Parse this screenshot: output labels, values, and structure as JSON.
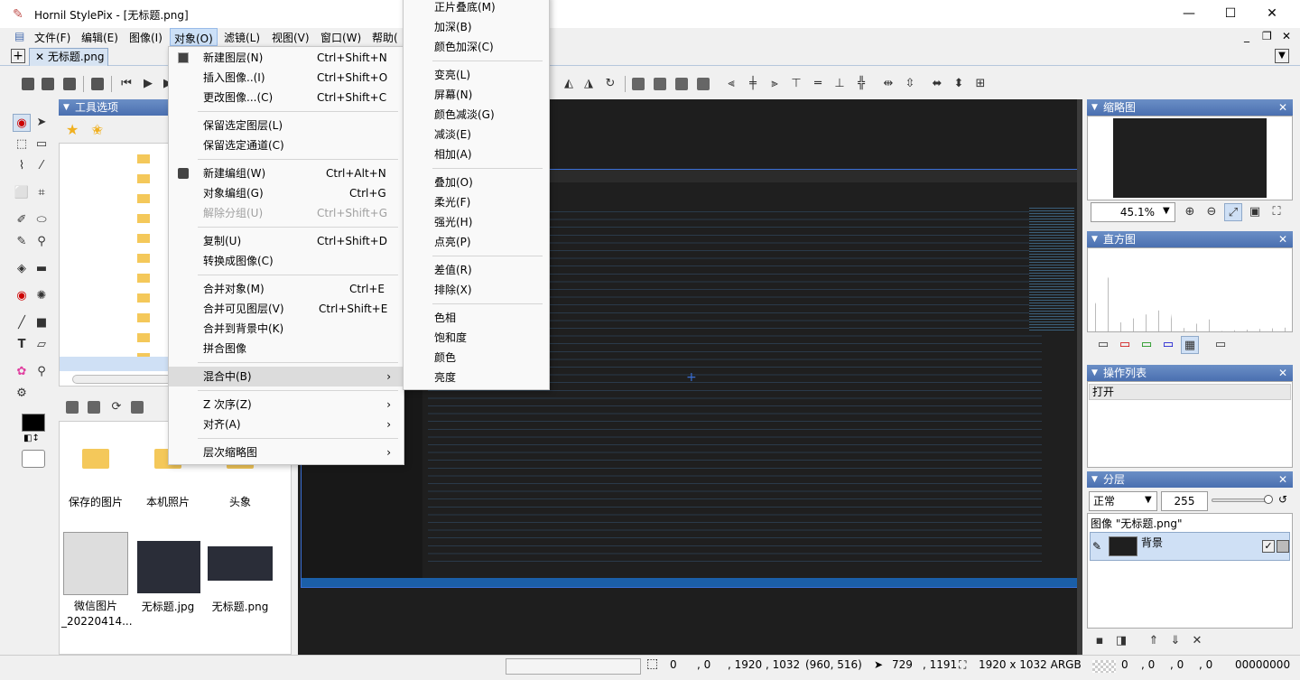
{
  "window": {
    "title": "Hornil StylePix - [无标题.png]"
  },
  "menubar": {
    "items": [
      "文件(F)",
      "编辑(E)",
      "图像(I)",
      "对象(O)",
      "滤镜(L)",
      "视图(V)",
      "窗口(W)",
      "帮助("
    ]
  },
  "tabs": {
    "doc": "✕ 无标题.png"
  },
  "left_panel": {
    "title": "工具选项"
  },
  "files": [
    {
      "name": "保存的图片"
    },
    {
      "name": "本机照片"
    },
    {
      "name": "头象"
    },
    {
      "name": "微信图片_20220414..."
    },
    {
      "name": "无标题.jpg"
    },
    {
      "name": "无标题.png"
    }
  ],
  "object_menu": {
    "items": [
      {
        "label": "新建图层(N)",
        "shortcut": "Ctrl+Shift+N"
      },
      {
        "label": "插入图像..(I)",
        "shortcut": "Ctrl+Shift+O"
      },
      {
        "label": "更改图像...(C)",
        "shortcut": "Ctrl+Shift+C"
      },
      {
        "label": "保留选定图层(L)",
        "shortcut": ""
      },
      {
        "label": "保留选定通道(C)",
        "shortcut": ""
      },
      {
        "label": "新建编组(W)",
        "shortcut": "Ctrl+Alt+N"
      },
      {
        "label": "对象编组(G)",
        "shortcut": "Ctrl+G"
      },
      {
        "label": "解除分组(U)",
        "shortcut": "Ctrl+Shift+G"
      },
      {
        "label": "复制(U)",
        "shortcut": "Ctrl+Shift+D"
      },
      {
        "label": "转换成图像(C)",
        "shortcut": ""
      },
      {
        "label": "合并对象(M)",
        "shortcut": "Ctrl+E"
      },
      {
        "label": "合并可见图层(V)",
        "shortcut": "Ctrl+Shift+E"
      },
      {
        "label": "合并到背景中(K)",
        "shortcut": ""
      },
      {
        "label": "拼合图像",
        "shortcut": ""
      },
      {
        "label": "混合中(B)",
        "shortcut": ""
      },
      {
        "label": "Z 次序(Z)",
        "shortcut": ""
      },
      {
        "label": "对齐(A)",
        "shortcut": ""
      },
      {
        "label": "层次缩略图",
        "shortcut": ""
      }
    ]
  },
  "blend_menu": {
    "items": [
      "正片叠底(M)",
      "加深(B)",
      "颜色加深(C)",
      "变亮(L)",
      "屏幕(N)",
      "颜色减淡(G)",
      "减淡(E)",
      "相加(A)",
      "叠加(O)",
      "柔光(F)",
      "强光(H)",
      "点亮(P)",
      "差值(R)",
      "排除(X)",
      "色相",
      "饱和度",
      "颜色",
      "亮度"
    ]
  },
  "right": {
    "navigator_title": "缩略图",
    "zoom": "45.1%",
    "histogram_title": "直方图",
    "history_title": "操作列表",
    "history_item": "打开",
    "layers_title": "分层",
    "blend_mode": "正常",
    "opacity": "255",
    "image_label": "图像 \"无标题.png\"",
    "layer_name": "背景"
  },
  "status": {
    "sel_x": "0",
    "sel_y": ", 0",
    "sel_size": ", 1920 , 1032",
    "center": "(960, 516)",
    "cursor_x": "729",
    "cursor_y": ", 1191",
    "image_info": "1920 x 1032 ARGB",
    "c1": "0",
    "c2": ", 0",
    "c3": ", 0",
    "c4": ", 0",
    "hex": "00000000"
  },
  "colors": {
    "accent": "#4a6fb0",
    "selection": "#3a6fd6",
    "canvas": "#1e1e1e"
  }
}
